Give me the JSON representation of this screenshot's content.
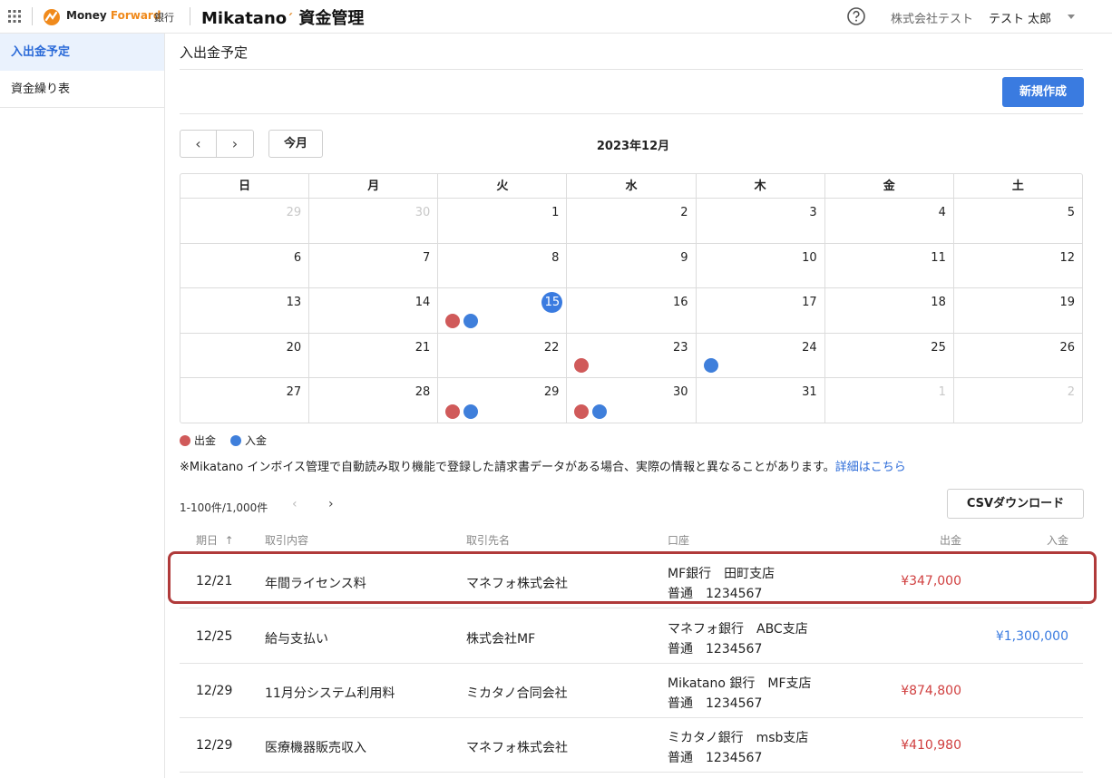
{
  "header": {
    "mf_brand_prefix": "Money ",
    "mf_brand_suffix": "Forward",
    "mf_bank": "銀行",
    "app_name": "Mikatano",
    "app_module": "資金管理",
    "company": "株式会社テスト",
    "user": "テスト 太郎"
  },
  "sidebar": {
    "items": [
      {
        "label": "入出金予定",
        "active": true
      },
      {
        "label": "資金繰り表",
        "active": false
      }
    ]
  },
  "page": {
    "title": "入出金予定",
    "new_button": "新規作成",
    "today_button": "今月",
    "prev_symbol": "‹",
    "next_symbol": "›",
    "month_title": "2023年12月"
  },
  "calendar": {
    "weekdays": [
      "日",
      "月",
      "火",
      "水",
      "木",
      "金",
      "土"
    ],
    "weeks": [
      [
        {
          "d": "29",
          "other": true
        },
        {
          "d": "30",
          "other": true
        },
        {
          "d": "1"
        },
        {
          "d": "2"
        },
        {
          "d": "3"
        },
        {
          "d": "4"
        },
        {
          "d": "5"
        }
      ],
      [
        {
          "d": "6"
        },
        {
          "d": "7"
        },
        {
          "d": "8"
        },
        {
          "d": "9"
        },
        {
          "d": "10"
        },
        {
          "d": "11"
        },
        {
          "d": "12"
        }
      ],
      [
        {
          "d": "13"
        },
        {
          "d": "14"
        },
        {
          "d": "15",
          "today": true,
          "dots": [
            "out",
            "in"
          ]
        },
        {
          "d": "16"
        },
        {
          "d": "17"
        },
        {
          "d": "18"
        },
        {
          "d": "19"
        }
      ],
      [
        {
          "d": "20"
        },
        {
          "d": "21"
        },
        {
          "d": "22"
        },
        {
          "d": "23",
          "dots": [
            "out"
          ]
        },
        {
          "d": "24",
          "dots": [
            "in"
          ]
        },
        {
          "d": "25"
        },
        {
          "d": "26"
        }
      ],
      [
        {
          "d": "27"
        },
        {
          "d": "28"
        },
        {
          "d": "29",
          "dots": [
            "out",
            "in"
          ]
        },
        {
          "d": "30",
          "dots": [
            "out",
            "in"
          ]
        },
        {
          "d": "31"
        },
        {
          "d": "1",
          "other": true
        },
        {
          "d": "2",
          "other": true
        }
      ]
    ],
    "colors": {
      "out": "#d05a5a",
      "in": "#3f7fdb"
    }
  },
  "legend": {
    "out_label": "出金",
    "in_label": "入金"
  },
  "notice": {
    "text": "※Mikatano インボイス管理で自動読み取り機能で登録した請求書データがある場合、実際の情報と異なることがあります。",
    "link": "詳細はこちら"
  },
  "pagination": {
    "range": "1-100件/1,000件",
    "prev": "‹",
    "next": "›"
  },
  "csv_button": "CSVダウンロード",
  "table": {
    "headers": {
      "date": "期日",
      "sort_arrow": "↑",
      "desc": "取引内容",
      "partner": "取引先名",
      "account": "口座",
      "out": "出金",
      "in": "入金"
    },
    "rows": [
      {
        "date": "12/21",
        "desc": "年間ライセンス料",
        "partner": "マネフォ株式会社",
        "acct_bank": "MF銀行　田町支店",
        "acct_no": "普通　1234567",
        "out": "¥347,000",
        "in": ""
      },
      {
        "date": "12/25",
        "desc": "給与支払い",
        "partner": "株式会社MF",
        "acct_bank": "マネフォ銀行　ABC支店",
        "acct_no": "普通　1234567",
        "out": "",
        "in": "¥1,300,000"
      },
      {
        "date": "12/29",
        "desc": "11月分システム利用料",
        "partner": "ミカタノ合同会社",
        "acct_bank": "Mikatano 銀行　MF支店",
        "acct_no": "普通　1234567",
        "out": "¥874,800",
        "in": ""
      },
      {
        "date": "12/29",
        "desc": "医療機器販売収入",
        "partner": "マネフォ株式会社",
        "acct_bank": "ミカタノ銀行　msb支店",
        "acct_no": "普通　1234567",
        "out": "¥410,980",
        "in": ""
      }
    ]
  }
}
